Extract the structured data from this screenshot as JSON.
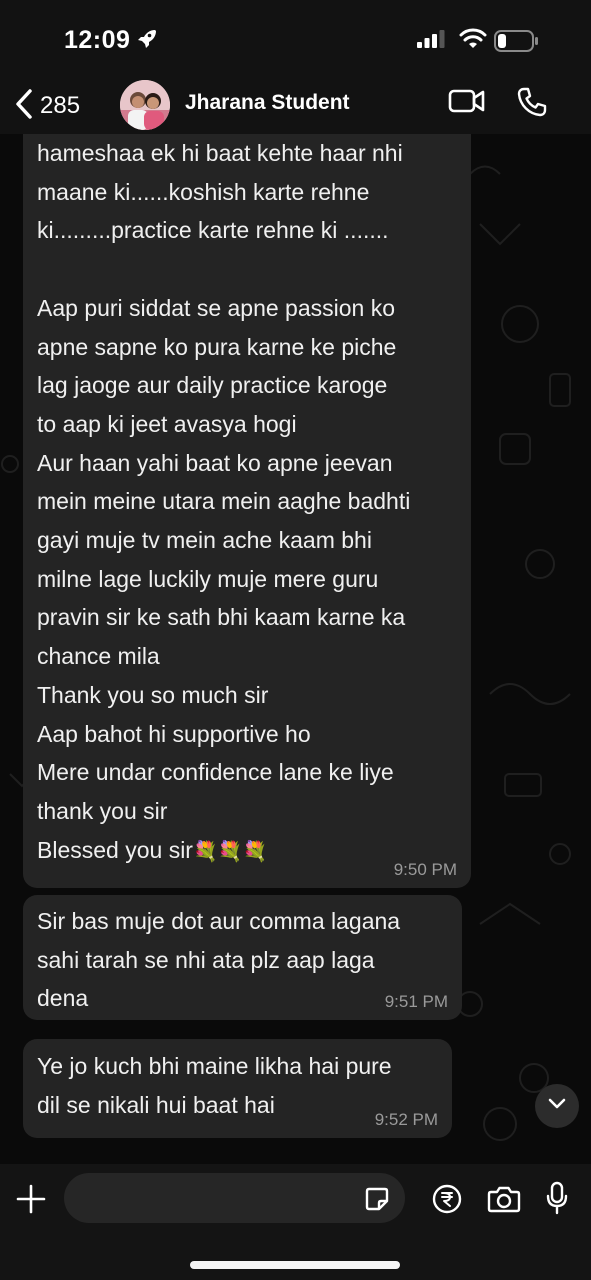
{
  "status_bar": {
    "time": "12:09",
    "battery_level": 0.25
  },
  "header": {
    "back_count": "285",
    "contact_name": "Jharana Student",
    "icons": [
      "chevron-left-icon",
      "video-call-icon",
      "phone-icon"
    ]
  },
  "messages": [
    {
      "text": "hameshaa ek hi baat kehte haar nhi\nmaane ki......koshish karte rehne\nki.........practice karte rehne ki .......\n\nAap puri siddat se apne passion ko\napne sapne ko pura karne ke piche\nlag jaoge aur daily practice karoge\nto aap ki jeet avasya hogi\nAur haan yahi baat ko apne jeevan\nmein meine utara mein aaghe badhti\ngayi muje tv mein ache kaam bhi\nmilne lage luckily muje mere guru\npravin sir ke sath bhi kaam karne ka\nchance mila\nThank you so much sir\nAap bahot hi supportive ho\nMere undar confidence lane ke liye\nthank you sir\nBlessed you sir",
      "emoji": "💐💐💐",
      "time": "9:50 PM"
    },
    {
      "text": "Sir bas muje dot aur comma lagana\nsahi tarah se nhi ata plz aap laga\ndena",
      "time": "9:51 PM"
    },
    {
      "text": "Ye jo kuch bhi maine likha hai pure\ndil se nikali hui baat hai",
      "time": "9:52 PM"
    }
  ],
  "composer": {
    "input_value": "",
    "icons": [
      "plus-icon",
      "sticker-icon",
      "rupee-payment-icon",
      "camera-icon",
      "microphone-icon"
    ]
  },
  "colors": {
    "background": "#0a0a0a",
    "bubble": "#242424",
    "header": "#121212",
    "timestamp": "#9a9a9a"
  }
}
